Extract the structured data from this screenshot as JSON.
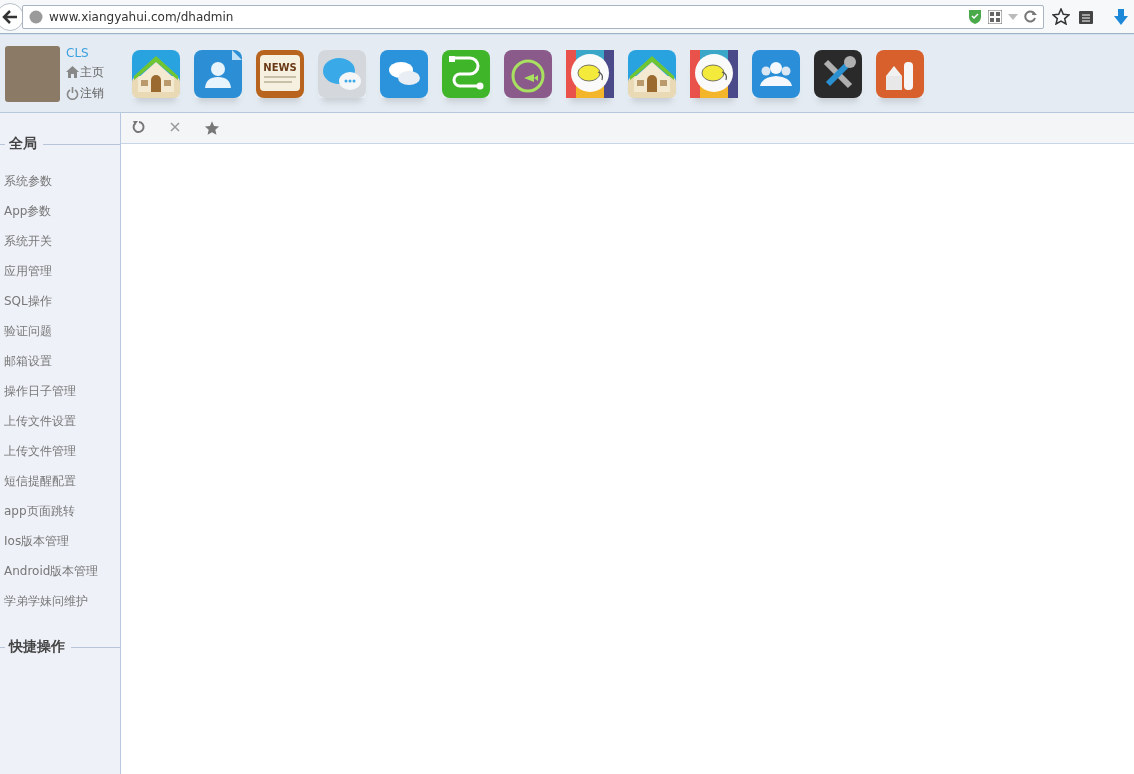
{
  "browser": {
    "url": "www.xiangyahui.com/dhadmin"
  },
  "user": {
    "name": "CLS",
    "links": [
      {
        "kind": "home",
        "label": "主页"
      },
      {
        "kind": "logout",
        "label": "注销"
      }
    ]
  },
  "apps": [
    {
      "kind": "house"
    },
    {
      "kind": "contact"
    },
    {
      "kind": "news",
      "label": "NEWS"
    },
    {
      "kind": "chat-grey"
    },
    {
      "kind": "chat-blue"
    },
    {
      "kind": "flow"
    },
    {
      "kind": "fishbowl"
    },
    {
      "kind": "elephant"
    },
    {
      "kind": "house"
    },
    {
      "kind": "elephant"
    },
    {
      "kind": "group"
    },
    {
      "kind": "tools"
    },
    {
      "kind": "shapes"
    }
  ],
  "sidebar": {
    "sections": [
      {
        "title": "全局",
        "items": [
          "系统参数",
          "App参数",
          "系统开关",
          "应用管理",
          "SQL操作",
          "验证问题",
          "邮箱设置",
          "操作日子管理",
          "上传文件设置",
          "上传文件管理",
          "短信提醒配置",
          "app页面跳转",
          "Ios版本管理",
          "Android版本管理",
          "学弟学妹问维护"
        ]
      },
      {
        "title": "快捷操作"
      }
    ]
  }
}
